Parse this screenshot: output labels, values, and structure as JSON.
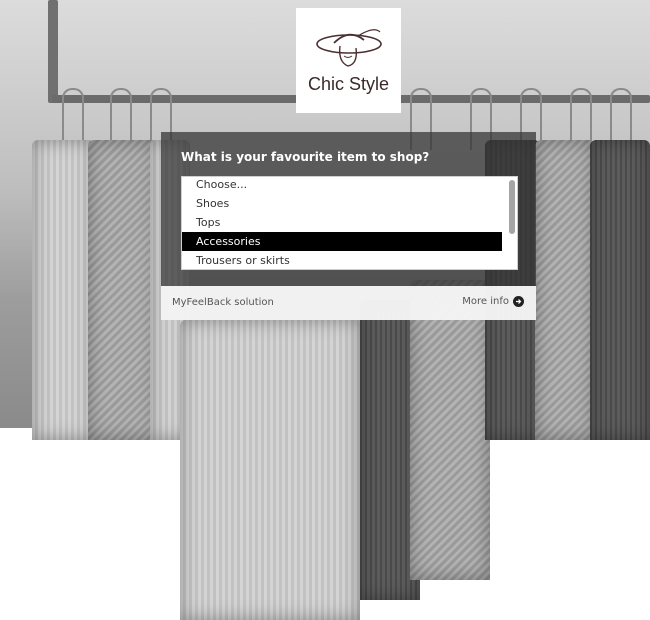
{
  "logo": {
    "text": "Chic Style",
    "icon": "woman-with-hat-icon"
  },
  "survey": {
    "question": "What is your favourite item to shop?",
    "options": [
      "Choose...",
      "Shoes",
      "Tops",
      "Accessories",
      "Trousers or skirts"
    ],
    "selected": "Accessories"
  },
  "footer": {
    "brand": "MyFeelBack solution",
    "more_info": "More info",
    "more_info_icon": "arrow-right-circle-icon"
  },
  "colors": {
    "selected_bg": "#000000",
    "panel_bg": "#323232",
    "logo_text": "#3a2a2a"
  }
}
